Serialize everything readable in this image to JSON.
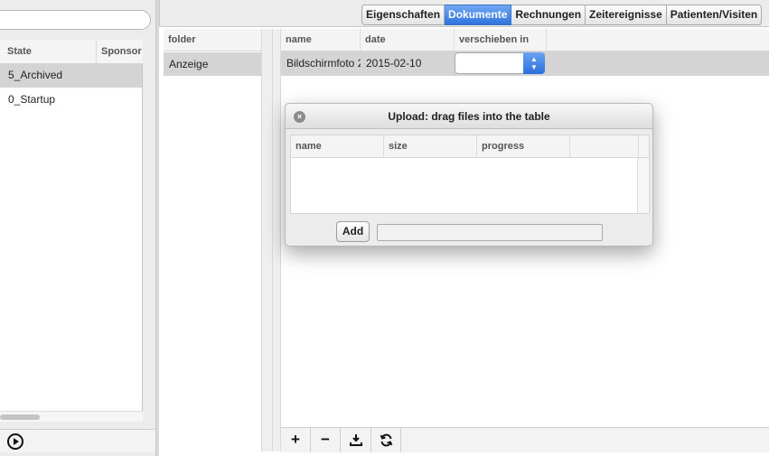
{
  "left": {
    "columns": [
      "State",
      "Sponsor"
    ],
    "rows": [
      {
        "state": "5_Archived",
        "selected": true
      },
      {
        "state": "0_Startup",
        "selected": false
      }
    ],
    "play_icon": "play-circle-icon"
  },
  "tabs": [
    {
      "label": "Eigenschaften",
      "active": false
    },
    {
      "label": "Dokumente",
      "active": true
    },
    {
      "label": "Rechnungen",
      "active": false
    },
    {
      "label": "Zeitereignisse",
      "active": false
    },
    {
      "label": "Patienten/Visiten",
      "active": false
    }
  ],
  "folders": {
    "header": "folder",
    "items": [
      "Anzeige"
    ]
  },
  "documents": {
    "columns": [
      "name",
      "date",
      "verschieben in"
    ],
    "rows": [
      {
        "name": "Bildschirmfoto 2",
        "date": "2015-02-10",
        "move_to": ""
      }
    ]
  },
  "toolbar": {
    "add_icon": "plus-icon",
    "add_label": "+",
    "remove_icon": "minus-icon",
    "remove_label": "−",
    "download_icon": "download-icon",
    "refresh_icon": "refresh-icon"
  },
  "upload_dialog": {
    "title": "Upload: drag files into the table",
    "columns": [
      "name",
      "size",
      "progress"
    ],
    "add_label": "Add",
    "close_icon": "close-icon",
    "close_label": "×"
  },
  "colors": {
    "accent": "#2f73dd",
    "selection": "#d4d4d4"
  }
}
